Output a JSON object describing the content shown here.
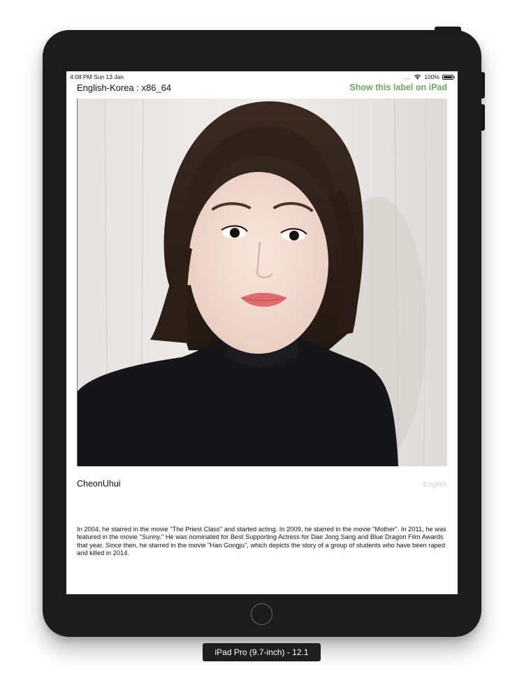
{
  "status_bar": {
    "time_date": "4:08 PM   Sun 13 Jan",
    "signal": "....",
    "wifi_icon": "wifi-icon",
    "battery_percent": "100%",
    "battery_icon": "battery-icon"
  },
  "nav": {
    "title_left": "English-Korea : x86_64",
    "action_right": "Show this label on iPad",
    "action_color": "#6aaa5a"
  },
  "profile": {
    "name": "CheonUhui",
    "language": "English",
    "bio": "In 2004, he starred in the movie \"The Priest Class\" and started acting. In 2009, he starred in the movie \"Mother\". In 2011, he was featured in the movie \"Sunny.\" He was nominated for Best Supporting Actress for Dae Jong Sang and Blue Dragon Film Awards that year. Since then, he starred in the movie \"Han Gongju\", which depicts the story of a group of students who have been raped and killed in 2014."
  },
  "device": {
    "label": "iPad Pro (9.7-inch) - 12.1"
  }
}
